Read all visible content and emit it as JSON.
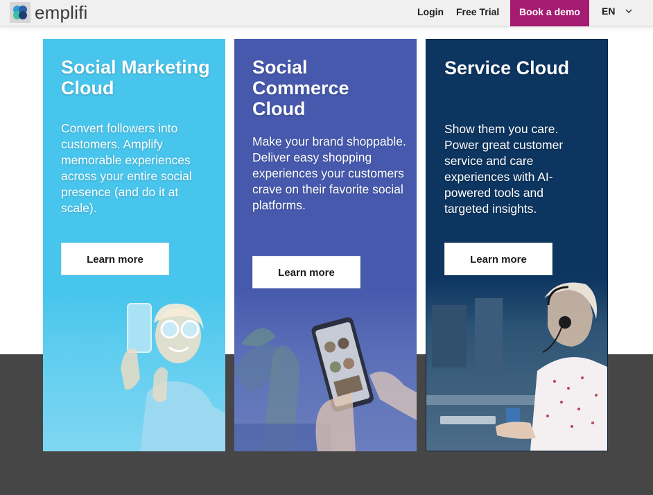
{
  "header": {
    "logo_text": "emplifi",
    "nav": {
      "login": "Login",
      "free_trial": "Free Trial"
    },
    "cta": "Book a demo",
    "language": "EN"
  },
  "colors": {
    "header_bg": "#f0f0f0",
    "cta_bg": "#a51b6f",
    "dark_band": "#464646",
    "card_1": "#48c5ec",
    "card_2": "#4659ad",
    "card_3": "#0c3560"
  },
  "cards": [
    {
      "title": "Social Marketing Cloud",
      "description": "Convert followers into customers. Amplify memorable experiences across your entire social presence (and do it at scale).",
      "button": "Learn more",
      "image": "woman-taking-selfie-photo"
    },
    {
      "title": "Social Commerce Cloud",
      "description": "Make your brand shoppable. Deliver easy shopping experiences your customers crave on their favorite social platforms.",
      "button": "Learn more",
      "image": "hand-holding-phone-shopping-app-photo"
    },
    {
      "title": "Service Cloud",
      "description": "Show them you care. Power great customer service and care experiences with AI-powered tools and targeted insights.",
      "button": "Learn more",
      "image": "support-agent-with-headset-photo"
    }
  ]
}
